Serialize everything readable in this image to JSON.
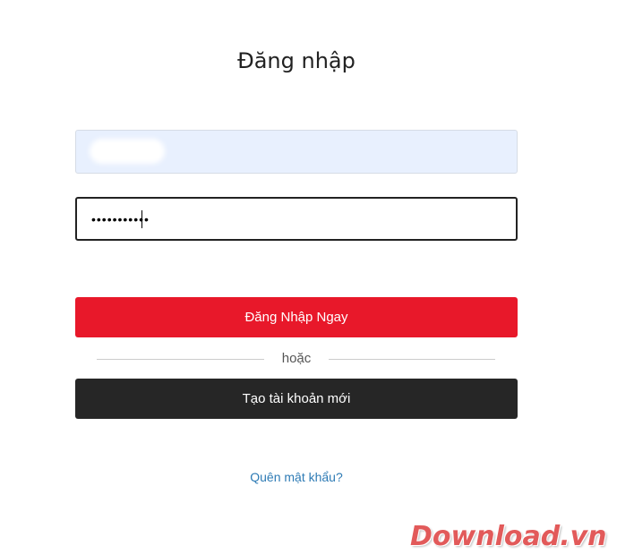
{
  "page": {
    "title": "Đăng nhập"
  },
  "form": {
    "username_value": "",
    "password_value": "•••••••••••",
    "login_label": "Đăng Nhập Ngay",
    "divider_label": "hoặc",
    "register_label": "Tạo tài khoản mới",
    "forgot_label": "Quên mật khẩu?"
  },
  "watermark": {
    "text": "Download.vn"
  },
  "colors": {
    "login_button": "#e8182a",
    "register_button": "#262626",
    "link": "#2e7bb5",
    "username_bg": "#e8f0fe"
  }
}
